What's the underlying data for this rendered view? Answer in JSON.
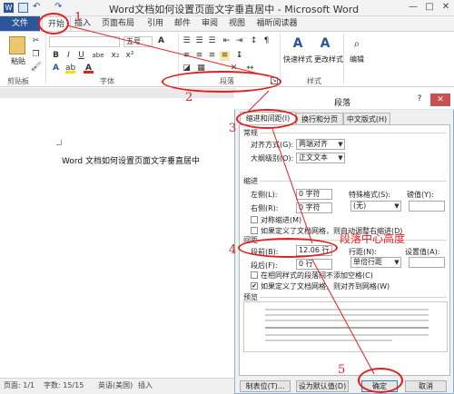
{
  "window": {
    "title": "Word文档如何设置页面文字垂直居中 - Microsoft Word",
    "minimize": "—",
    "restore": "□",
    "close": "✕"
  },
  "tabs": [
    "文件",
    "开始",
    "插入",
    "页面布局",
    "引用",
    "邮件",
    "审阅",
    "视图",
    "福昕阅读器"
  ],
  "ribbon": {
    "paste_label": "粘贴",
    "clipboard_group": "剪贴板",
    "font_group": "字体",
    "paragraph_group": "段落",
    "styles_group": "样式",
    "editing_group": "编辑",
    "font_size": "五号",
    "quick_styles": "快速样式",
    "change_styles": "更改样式",
    "editing": "编辑",
    "font_btns": [
      "B",
      "I",
      "U",
      "abe",
      "x₂",
      "x²"
    ],
    "aa_label": "A"
  },
  "document": {
    "text": "Word 文档如何设置页面文字垂直居中"
  },
  "statusbar": {
    "page": "页面: 1/1",
    "words": "字数: 15/15",
    "language": "英语(美国)",
    "mode": "插入"
  },
  "dialog": {
    "title": "段落",
    "help": "?",
    "close": "✕",
    "tabs": [
      "缩进和间距(I)",
      "换行和分页(P)",
      "中文版式(H)"
    ],
    "general": {
      "heading": "常规",
      "align_label": "对齐方式(G):",
      "align_value": "两端对齐",
      "outline_label": "大纲级别(O):",
      "outline_value": "正文文本"
    },
    "indent": {
      "heading": "缩进",
      "left_label": "左侧(L):",
      "left_value": "0 字符",
      "right_label": "右侧(R):",
      "right_value": "0 字符",
      "special_label": "特殊格式(S):",
      "special_value": "(无)",
      "measure_label": "磅值(Y):",
      "mirror_label": "对称缩进(M)",
      "auto_label": "如果定义了文档网格，则自动调整右缩进(D)"
    },
    "spacing": {
      "heading": "间距",
      "before_label": "段前(B):",
      "before_value": "12.06 行",
      "after_label": "段后(F):",
      "after_value": "0 行",
      "line_label": "行距(N):",
      "line_value": "单倍行距",
      "at_label": "设置值(A):",
      "no_space_label": "在相同样式的段落间不添加空格(C)",
      "snap_label": "如果定义了文档网格，则对齐到网格(W)",
      "snap_checked": "✔"
    },
    "preview_heading": "预览",
    "buttons": {
      "tabs": "制表位(T)...",
      "default": "设为默认值(D)",
      "ok": "确定",
      "cancel": "取消"
    }
  },
  "annotations": {
    "n1": "1",
    "n2": "2",
    "n3": "3",
    "n4": "4",
    "n5": "5",
    "note": "段落中心高度"
  },
  "colors": {
    "accent": "#2b579a",
    "annotation": "#e02020"
  }
}
